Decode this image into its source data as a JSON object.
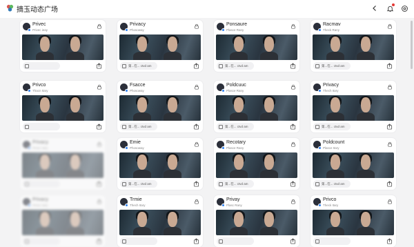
{
  "app": {
    "title": "摘玉动态广场",
    "colors": {
      "accent": "#2f80ed",
      "notification": "#e53935"
    }
  },
  "header_icons": [
    "back-icon",
    "bell-icon",
    "settings-icon"
  ],
  "cards": [
    {
      "title": "Privec",
      "subtitle": "Privec ieay",
      "footer": "",
      "faded": false
    },
    {
      "title": "Privacy",
      "subtitle": "Phosoway",
      "footer": "第...在... ctvd am",
      "faded": false
    },
    {
      "title": "Ponsaure",
      "subtitle": "Plasce Rany",
      "footer": "第...在... ctvd am",
      "faded": false
    },
    {
      "title": "Racmav",
      "subtitle": "Theck Rany",
      "footer": "第...在... ctvd am",
      "faded": false
    },
    {
      "title": "Privco",
      "subtitle": "Thacn Itary",
      "footer": "",
      "faded": false
    },
    {
      "title": "Fsacce",
      "subtitle": "Phosoway",
      "footer": "第...在... ctvd am",
      "faded": false
    },
    {
      "title": "Poldcuuc",
      "subtitle": "Plasce Rany",
      "footer": "第...在... ctvd am",
      "faded": false
    },
    {
      "title": "Privacy",
      "subtitle": "Thech Itary",
      "footer": "第...在... ctvd am",
      "faded": false
    },
    {
      "title": "Privacy",
      "subtitle": "Privec Itary",
      "footer": "",
      "faded": true
    },
    {
      "title": "Emie",
      "subtitle": "Phosoway",
      "footer": "第...在... ctvd am",
      "faded": false
    },
    {
      "title": "Recotary",
      "subtitle": "Plasce Rany",
      "footer": "第...在... ctvd am",
      "faded": false
    },
    {
      "title": "Poldcount",
      "subtitle": "Plasce Itary",
      "footer": "第...在... ctvd am",
      "faded": false
    },
    {
      "title": "Privacy",
      "subtitle": "Privec Itary",
      "footer": "",
      "faded": true
    },
    {
      "title": "Trmie",
      "subtitle": "Thech Itary",
      "footer": "",
      "faded": false
    },
    {
      "title": "Privay",
      "subtitle": "Plasc Rany",
      "footer": "",
      "faded": false
    },
    {
      "title": "Privco",
      "subtitle": "Theck Itary",
      "footer": "",
      "faded": false
    }
  ]
}
